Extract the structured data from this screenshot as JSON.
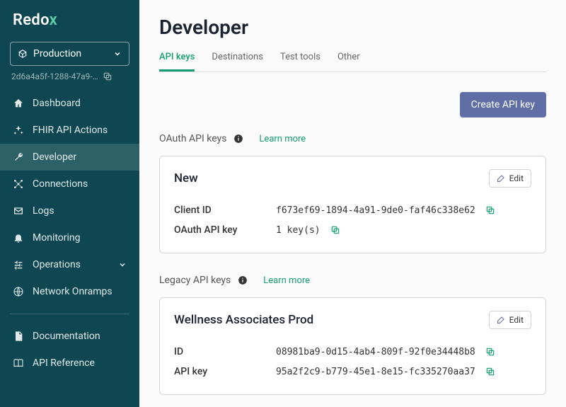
{
  "brand": {
    "name": "Redo",
    "suffix": "x"
  },
  "env": {
    "label": "Production",
    "id": "2d6a4a5f-1288-47a9-…"
  },
  "nav": {
    "items": [
      {
        "label": "Dashboard"
      },
      {
        "label": "FHIR API Actions"
      },
      {
        "label": "Developer"
      },
      {
        "label": "Connections"
      },
      {
        "label": "Logs"
      },
      {
        "label": "Monitoring"
      },
      {
        "label": "Operations"
      },
      {
        "label": "Network Onramps"
      }
    ],
    "footer": [
      {
        "label": "Documentation"
      },
      {
        "label": "API Reference"
      }
    ]
  },
  "page": {
    "title": "Developer",
    "tabs": [
      "API keys",
      "Destinations",
      "Test tools",
      "Other"
    ],
    "create_btn": "Create API key",
    "learn_more": "Learn more",
    "edit": "Edit",
    "oauth": {
      "heading": "OAuth API keys",
      "card_title": "New",
      "rows": {
        "client_id_label": "Client ID",
        "client_id_value": "f673ef69-1894-4a91-9de0-faf46c338e62",
        "key_label": "OAuth API key",
        "key_value": "1 key(s)"
      }
    },
    "legacy": {
      "heading": "Legacy API keys",
      "card_title": "Wellness Associates Prod",
      "rows": {
        "id_label": "ID",
        "id_value": "08981ba9-0d15-4ab4-809f-92f0e34448b8",
        "key_label": "API key",
        "key_value": "95a2f2c9-b779-45e1-8e15-fc335270aa37"
      }
    }
  }
}
